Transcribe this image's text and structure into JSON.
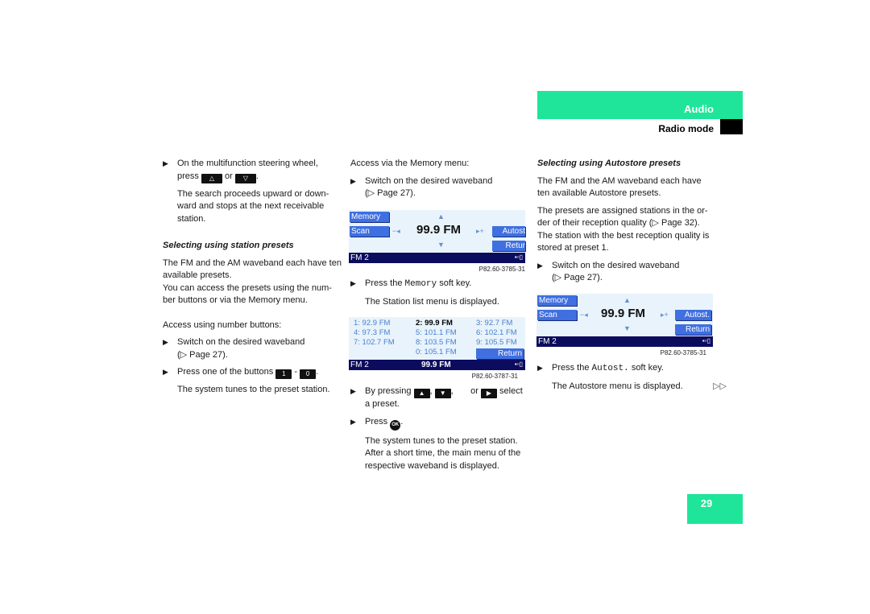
{
  "header": {
    "section": "Audio",
    "subsection": "Radio mode",
    "accent_color": "#1ee59a"
  },
  "page_number": "29",
  "col1": {
    "step1_text_a": "On the multifunction steering wheel,",
    "step1_text_b": "press",
    "step1_or": "or",
    "key_up_icon": "⌂",
    "key_down_icon": "▽",
    "step1_result": "The search proceeds upward or down-ward and stops at the next receivable station.",
    "heading": "Selecting using station presets",
    "para1": "The FM and the AM waveband each have ten available presets.",
    "para2": "You can access the presets using the num-ber buttons or via the Memory menu.",
    "access_label": "Access using number buttons:",
    "step2": "Switch on the desired waveband",
    "step2_ref": "(▷ Page 27).",
    "step3_a": "Press one of the buttons",
    "step3_key1": "1",
    "step3_dash": "-",
    "step3_key0": "0",
    "step3_result": "The system tunes to the preset station."
  },
  "col2": {
    "access_label": "Access via the Memory menu:",
    "step1": "Switch on the desired waveband",
    "step1_ref": "(▷ Page 27).",
    "screen1": {
      "softkey_memory": "Memory",
      "softkey_scan": "Scan",
      "softkey_autost": "Autost",
      "softkey_return": "Retur",
      "frequency": "99.9 FM",
      "band": "FM 2",
      "caption": "P82.60-3785-31"
    },
    "step2_a": "Press the",
    "step2_key": "Memory",
    "step2_b": "soft key.",
    "step2_result": "The Station list menu is displayed.",
    "screen2": {
      "presets": [
        {
          "label": "1: 92.9 FM",
          "active": false
        },
        {
          "label": "2: 99.9 FM",
          "active": true
        },
        {
          "label": "3: 92.7 FM",
          "active": false
        },
        {
          "label": "4: 97.3 FM",
          "active": false
        },
        {
          "label": "5: 101.1 FM",
          "active": false
        },
        {
          "label": "6: 102.1 FM",
          "active": false
        },
        {
          "label": "7: 102.7 FM",
          "active": false
        },
        {
          "label": "8: 103.5 FM",
          "active": false
        },
        {
          "label": "9: 105.5 FM",
          "active": false
        },
        {
          "label": "0: 105.1 FM",
          "active": false
        }
      ],
      "softkey_return": "Return",
      "band": "FM 2",
      "frequency": "99.9 FM",
      "caption": "P82.60-3787-31"
    },
    "step3_a": "By pressing",
    "step3_comma": ",",
    "step3_or": "or",
    "step3_b": "select",
    "step3_c": "a preset.",
    "step4_a": "Press",
    "step4_key": "OK",
    "step4_result": "The system tunes to the preset station. After a short time, the main menu of the respective waveband is displayed."
  },
  "col3": {
    "heading": "Selecting using Autostore presets",
    "para1": "The FM and the AM waveband each have ten available Autostore presets.",
    "para2": "The presets are assigned stations in the or-der of their reception quality (▷ Page 32). The station with the best reception quality is stored at preset 1.",
    "step1": "Switch on the desired waveband",
    "step1_ref": "(▷ Page 27).",
    "screen": {
      "softkey_memory": "Memory",
      "softkey_scan": "Scan",
      "softkey_autost": "Autost.",
      "softkey_return": "Return",
      "frequency": "99.9 FM",
      "band": "FM 2",
      "caption": "P82.60-3785-31"
    },
    "step2_a": "Press the",
    "step2_key": "Autost.",
    "step2_b": "soft key.",
    "step2_result": "The Autostore menu is displayed.",
    "continue_marker": "▷▷"
  }
}
